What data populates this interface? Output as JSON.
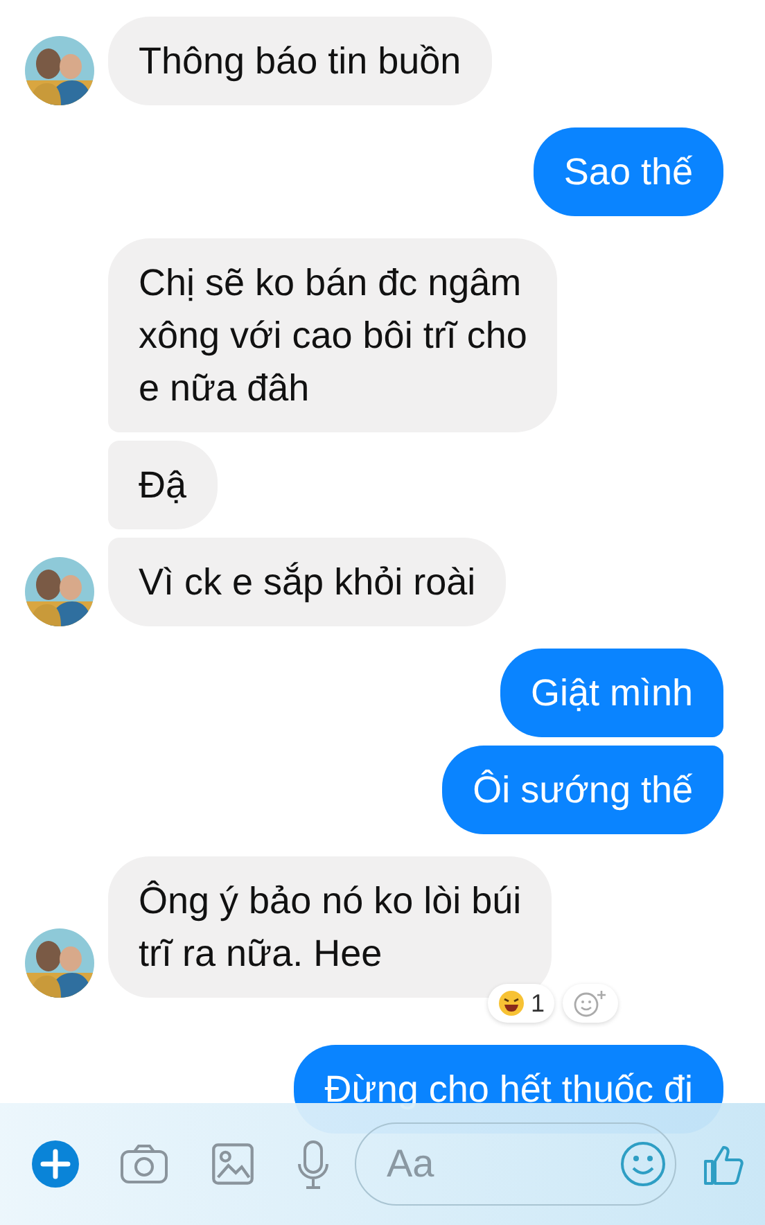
{
  "messages": [
    {
      "kind": "received",
      "text": "Thông báo tin buồn",
      "avatar": true
    },
    {
      "kind": "sent",
      "text": "Sao thế"
    },
    {
      "kind": "received",
      "text": "Chị sẽ ko bán đc ngâm\nxông với cao bôi trĩ cho\ne nữa đâh",
      "avatar": false
    },
    {
      "kind": "received",
      "text": "Đậ",
      "avatar": false
    },
    {
      "kind": "received",
      "text": "Vì ck e sắp khỏi roài",
      "avatar": true
    },
    {
      "kind": "sent",
      "text": "Giật mình"
    },
    {
      "kind": "sent",
      "text": "Ôi sướng thế"
    },
    {
      "kind": "received",
      "text": "Ông ý bảo nó ko lòi búi\ntrĩ ra nữa. Hee",
      "avatar": true,
      "reaction": {
        "count": "1"
      }
    },
    {
      "kind": "sent",
      "text": "Đừng cho hết thuốc đi"
    }
  ],
  "composer": {
    "placeholder": "Aa"
  }
}
